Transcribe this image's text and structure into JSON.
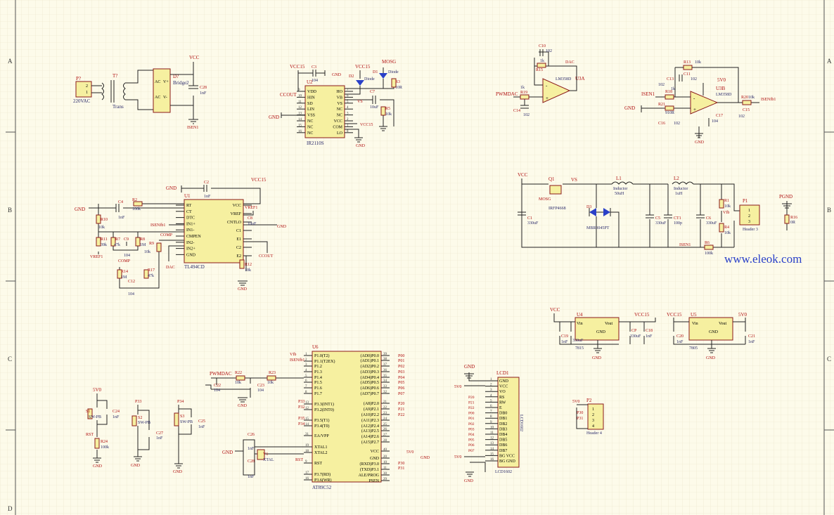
{
  "watermark": "www.eleok.com",
  "zones_left": [
    "A",
    "B",
    "C",
    "D"
  ],
  "zones_right": [
    "A",
    "B",
    "C",
    "D"
  ],
  "power_in": {
    "ref": "P?",
    "label": "220VAC",
    "pins": [
      "2",
      "1"
    ],
    "transformer": "T?",
    "trans_label": "Trans",
    "bridge_ref": "D?",
    "bridge_label": "Bridge2",
    "ac1": "AC",
    "ac2": "AC",
    "vplus": "V+",
    "vminus": "V-",
    "vcc": "VCC",
    "cap_ref": "C28",
    "cap_val": "1nF",
    "isen": "ISEN1"
  },
  "ir2110": {
    "ref": "U2",
    "part": "IR2110S",
    "left_pins": [
      "VDD",
      "HIN",
      "SD",
      "LIN",
      "VSS",
      "NC",
      "NC",
      "NC"
    ],
    "left_nums": [
      "9",
      "10",
      "11",
      "12",
      "13",
      "14",
      "15",
      "16"
    ],
    "right_pins": [
      "HO",
      "VB",
      "VS",
      "NC",
      "NC",
      "VCC",
      "COM",
      "LO"
    ],
    "right_nums": [
      "7",
      "6",
      "5",
      "4",
      "3",
      "2",
      "1",
      "8"
    ],
    "vcc15": "VCC15",
    "c3": "C3",
    "c3v": "104",
    "gnd": "GND",
    "ccout": "CCOUT",
    "d2": "D2",
    "d2l": "Diode",
    "d1": "D1",
    "d1l": "Diode",
    "c7": "C7",
    "c7v": "10uF",
    "r3": "R3",
    "r3v": "10R",
    "r5": "R5",
    "r5v": "10k",
    "mosg": "MOSG",
    "vs": "VS",
    "vcc15b": "VCC15"
  },
  "dac": {
    "u3a": "U3A",
    "part": "LM358D",
    "c10": "C10",
    "c10v": "102",
    "r15": "R15",
    "r15v": "1k",
    "r19": "R19",
    "r19v": "1k",
    "c14": "C14",
    "c14v": "102",
    "pwm": "PWMDAC",
    "dac": "DAC",
    "u3b": "U3B",
    "r13": "R13",
    "r13v": "10k",
    "c13": "C13",
    "c13v": "102",
    "c11": "C11",
    "c11v": "102",
    "r18": "R18",
    "r18v": "1k",
    "r21": "R21",
    "r21v": "910R",
    "c16": "C16",
    "c16v": "102",
    "c17": "C17",
    "c17v": "104",
    "r20": "R20",
    "r20v": "10k",
    "c15": "C15",
    "c15v": "102",
    "isen": "ISEN1",
    "isenfb": "ISENfb1",
    "v5": "5V0",
    "gnd": "GND"
  },
  "tl494": {
    "ref": "U1",
    "part": "TL494CD",
    "left_pins": [
      "RT",
      "CT",
      "DTC",
      "IN1+",
      "IN1-",
      "CMPEN",
      "IN2-",
      "IN2+",
      "GND"
    ],
    "right_pins": [
      "VCC",
      "VREF",
      "CNTLO",
      "C1",
      "E1",
      "C2",
      "E2"
    ],
    "vcc15": "VCC15",
    "c2": "C2",
    "c2v": "1nF",
    "c4": "C4",
    "c4v": "1nF",
    "r2": "R2",
    "r2v": "100k",
    "r10": "R10",
    "r10v": "10k",
    "r11": "R11",
    "r11v": "39k",
    "r7": "R7",
    "r7v": "47k",
    "c9": "C9",
    "c9v": "104",
    "r8": "R8",
    "r8v": "1M",
    "r9": "R9",
    "r9v": "10k",
    "r14": "R14",
    "r14v": "1M",
    "c12": "C12",
    "c12v": "104",
    "r17": "R17",
    "r17v": "47k",
    "c8": "C8",
    "c8v": "10uF",
    "r12": "R12",
    "r12v": "10k",
    "vref": "VREF1",
    "vref2": "VREF1",
    "isenfb": "ISENfb1",
    "comp": "COMP",
    "comp2": "COMP",
    "dac": "DAC",
    "ccout": "CCOUT",
    "gnd": "GND"
  },
  "buck": {
    "vcc": "VCC",
    "q1": "Q1",
    "q1p": "IRFP4668",
    "mosg": "MOSG",
    "vs": "VS",
    "l1": "L1",
    "l1l": "Inductor",
    "l1v": "50uH",
    "l2": "L2",
    "l2l": "Inductor",
    "l2v": "1uH",
    "c1": "C1",
    "c1v": "330uF",
    "d3": "D3",
    "d3p": "MBR3045PT",
    "c5": "C5",
    "c5v": "330uF",
    "ct1": "CT1",
    "ct1v": "100p",
    "c6": "C6",
    "c6v": "330uF",
    "r1": "R1",
    "r1v": "10k",
    "r4": "R4",
    "r4v": "10k",
    "r6": "R6",
    "r6v": "100k",
    "vfb": "Vfb",
    "isen": "ISEN1",
    "p1": "P1",
    "p1l": "Header 3",
    "pgnd": "PGND",
    "r16": "R16",
    "r16v": "0R"
  },
  "reg": {
    "u4": "U4",
    "u4p": "7815",
    "vcc": "VCC",
    "vcc15": "VCC15",
    "vin": "Vin",
    "vout": "Vout",
    "gnd": "GND",
    "c19": "C19",
    "c19v": "1nF",
    "c7": "C?",
    "cp": "CP",
    "cpv": "330uF",
    "c18": "C18",
    "c18v": "1nF",
    "c4": "C4",
    "c4v": "330uF",
    "u5": "U5",
    "u5p": "7805",
    "vcc15b": "VCC15",
    "v5": "5V0",
    "c20": "C20",
    "c20v": "1nF",
    "c21": "C21",
    "c21v": "1nF"
  },
  "mcu": {
    "ref": "U6",
    "part": "AT89C52",
    "left_pins": [
      "P1.0(T2)",
      "P1.1(T2EX)",
      "P1.2",
      "P1.3",
      "P1.4",
      "P1.5",
      "P1.6",
      "P1.7",
      "P3.3(INT1)",
      "P3.2(INT0)",
      "P3.5(T1)",
      "P3.4(T0)",
      "EA/VPP",
      "XTAL1",
      "XTAL2",
      "RST",
      "P3.7(RD)",
      "P3.6(WR)"
    ],
    "left_nums": [
      "1",
      "2",
      "3",
      "4",
      "5",
      "6",
      "7",
      "8",
      "13",
      "12",
      "15",
      "14",
      "31",
      "19",
      "18",
      "9",
      "17",
      "16"
    ],
    "right_pins": [
      "(AD0)P0.0",
      "(AD1)P0.1",
      "(AD2)P0.2",
      "(AD3)P0.3",
      "(AD4)P0.4",
      "(AD5)P0.5",
      "(AD6)P0.6",
      "(AD7)P0.7",
      "(A8)P2.0",
      "(A9)P2.1",
      "(A10)P2.2",
      "(A11)P2.3",
      "(A12)P2.4",
      "(A13)P2.5",
      "(A14)P2.6",
      "(A15)P2.7",
      "VCC",
      "GND",
      "(RXD)P3.0",
      "(TXD)P3.1",
      "ALE/PROG",
      "PSEN"
    ],
    "right_nums": [
      "39",
      "38",
      "37",
      "36",
      "35",
      "34",
      "33",
      "32",
      "21",
      "22",
      "23",
      "24",
      "25",
      "26",
      "27",
      "28",
      "40",
      "20",
      "10",
      "11",
      "30",
      "29"
    ],
    "nets": [
      "P00",
      "P01",
      "P02",
      "P03",
      "P04",
      "P05",
      "P06",
      "P07",
      "P20",
      "P21",
      "P22"
    ],
    "vfb": "Vfb",
    "isenfb": "ISENfb1",
    "pwm": "PWMDAC",
    "r22": "R22",
    "r22v": "10k",
    "r23": "R23",
    "r23v": "10k",
    "c22": "C22",
    "c22v": "104",
    "c23": "C23",
    "c23v": "104",
    "c26": "C26",
    "c26v": "1nF",
    "c28": "C28",
    "c28v": "1nF",
    "y1": "Y1",
    "y1l": "XTAL",
    "rst": "RST",
    "p30": "P30",
    "p31": "P31",
    "v5": "5V0",
    "gnd": "GND",
    "p33": "P33",
    "p32": "P32",
    "p35": "P35",
    "p34": "P34"
  },
  "lcd": {
    "ref": "LCD1",
    "part": "LCD1602",
    "pins": [
      "GND",
      "VCC",
      "VO",
      "RS",
      "RW",
      "E",
      "DB0",
      "DB1",
      "DB2",
      "DB3",
      "DB4",
      "DB5",
      "DB6",
      "DB7",
      "BG VCC",
      "BG GND"
    ],
    "nums": [
      "1",
      "2",
      "3",
      "4",
      "5",
      "6",
      "7",
      "8",
      "9",
      "10",
      "11",
      "12",
      "13",
      "14",
      "15",
      "16"
    ],
    "nets": [
      "P20",
      "P21",
      "P22",
      "P00",
      "P01",
      "P02",
      "P03",
      "P04",
      "P05",
      "P06",
      "P07"
    ],
    "v5": "5V0",
    "gnd": "GND",
    "side": "LCD1602"
  },
  "keys": {
    "v5": "5V0",
    "s1": "S1",
    "s1l": "SW-PB",
    "c24": "C24",
    "c24v": "1nF",
    "r24": "R24",
    "r24v": "100k",
    "rst": "RST",
    "s2": "S2",
    "s2l": "SW-PB",
    "p33": "P33",
    "c27": "C27",
    "c27v": "1nF",
    "s3": "S3",
    "s3l": "SW-PB",
    "p34": "P34",
    "c25": "C25",
    "c25v": "1nF",
    "gnd": "GND"
  },
  "header4": {
    "ref": "P2",
    "label": "Header 4",
    "v5": "5V0",
    "nets": [
      "P30",
      "P31"
    ],
    "pins": [
      "1",
      "2",
      "3",
      "4"
    ]
  }
}
